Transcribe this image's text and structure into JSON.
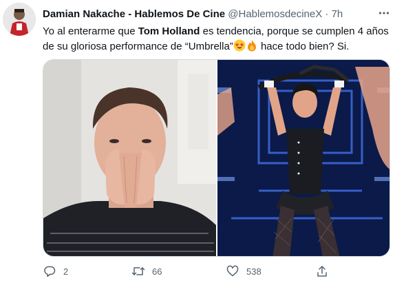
{
  "tweet": {
    "author_name": "Damian Nakache - Hablemos De Cine",
    "handle": "@HablemosdecineX",
    "separator": "·",
    "time": "7h",
    "text_before": "Yo al enterarme que ",
    "text_bold": "Tom Holland",
    "text_middle": " es tendencia, porque se cumplen 4 años de su gloriosa performance de “Umbrella”",
    "text_after": " hace todo bien? Si.",
    "emojis": [
      "star-struck-emoji",
      "fire-emoji"
    ]
  },
  "actions": {
    "reply_count": "2",
    "retweet_count": "66",
    "like_count": "538"
  },
  "colors": {
    "text_primary": "#0f1419",
    "text_secondary": "#536471",
    "border": "#cfd9de"
  },
  "icons": [
    "more-icon",
    "reply-icon",
    "retweet-icon",
    "like-icon",
    "share-icon"
  ]
}
